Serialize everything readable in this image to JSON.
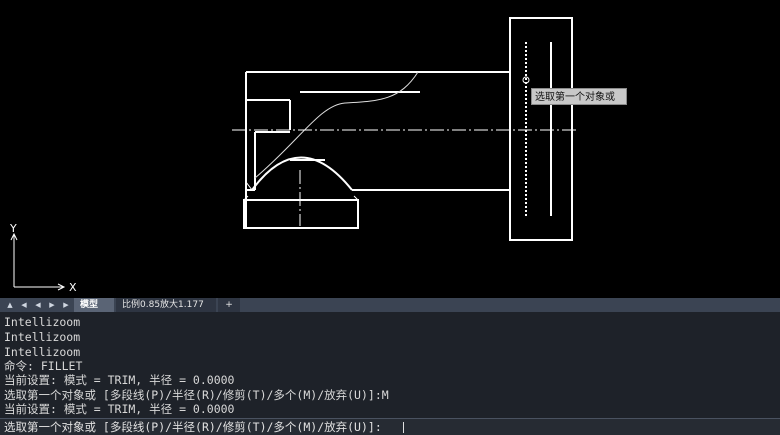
{
  "drawing": {
    "tooltip_text": "选取第一个对象或",
    "axis_y_label": "Y",
    "axis_x_label": "X"
  },
  "tabs": {
    "nav_icons": [
      "first-layout-icon",
      "prev-layout-icon",
      "next-layout-icon",
      "last-layout-icon"
    ],
    "items": [
      {
        "label": "模型",
        "active": true
      },
      {
        "label": "比例0.85放大1.177",
        "active": false
      },
      {
        "label": "+",
        "active": false
      }
    ]
  },
  "command_history": {
    "lines": [
      "Intellizoom",
      "Intellizoom",
      "Intellizoom",
      "命令: FILLET",
      "当前设置: 模式 = TRIM, 半径 = 0.0000",
      "选取第一个对象或 [多段线(P)/半径(R)/修剪(T)/多个(M)/放弃(U)]:M",
      "当前设置: 模式 = TRIM, 半径 = 0.0000"
    ]
  },
  "command_line": {
    "prompt": "选取第一个对象或 [多段线(P)/半径(R)/修剪(T)/多个(M)/放弃(U)]:",
    "value": ""
  },
  "colors": {
    "canvas_bg": "#000000",
    "line": "#ffffff",
    "tab_bar": "#3b4453",
    "tab_active": "#5a6475",
    "history_bg": "#1e2229"
  }
}
